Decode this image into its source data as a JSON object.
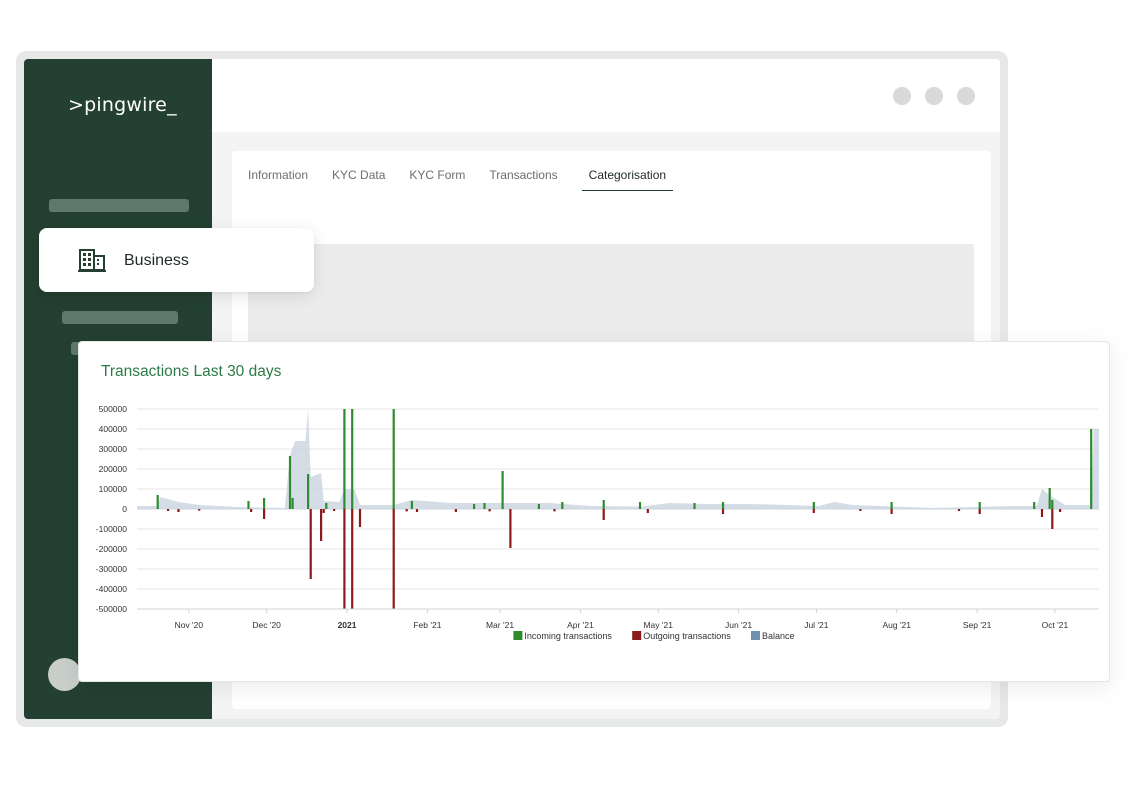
{
  "app": {
    "logo": ">pingwire_"
  },
  "tabs": [
    {
      "label": "Information",
      "active": false
    },
    {
      "label": "KYC Data",
      "active": false
    },
    {
      "label": "KYC Form",
      "active": false
    },
    {
      "label": "Transactions",
      "active": false
    },
    {
      "label": "Categorisation",
      "active": true
    }
  ],
  "business_card": {
    "label": "Business",
    "icon": "building-icon"
  },
  "colors": {
    "sidebar": "#234032",
    "accent": "#2e7a47",
    "incoming": "#2e8b2e",
    "outgoing": "#8b1a1a",
    "balance": "#c9d3de",
    "balance_legend": "#6f8faf"
  },
  "chart_data": {
    "type": "bar",
    "title": "Transactions Last 30 days",
    "ylim": [
      -500000,
      500000
    ],
    "y_ticks": [
      500000,
      400000,
      300000,
      200000,
      100000,
      0,
      -100000,
      -200000,
      -300000,
      -400000,
      -500000
    ],
    "x_ticks": [
      {
        "label": "Nov '20",
        "bold": false
      },
      {
        "label": "Dec '20",
        "bold": false
      },
      {
        "label": "2021",
        "bold": true
      },
      {
        "label": "Feb '21",
        "bold": false
      },
      {
        "label": "Mar '21",
        "bold": false
      },
      {
        "label": "Apr '21",
        "bold": false
      },
      {
        "label": "May '21",
        "bold": false
      },
      {
        "label": "Jun '21",
        "bold": false
      },
      {
        "label": "Jul '21",
        "bold": false
      },
      {
        "label": "Aug '21",
        "bold": false
      },
      {
        "label": "Sep '21",
        "bold": false
      },
      {
        "label": "Oct '21",
        "bold": false
      }
    ],
    "x_range": [
      "2020-10-12",
      "2021-10-18"
    ],
    "grid": true,
    "legend_position": "bottom",
    "series": [
      {
        "name": "Incoming transactions",
        "kind": "incoming",
        "points": [
          [
            "2020-10-20",
            70000
          ],
          [
            "2020-11-24",
            40000
          ],
          [
            "2020-11-30",
            55000
          ],
          [
            "2020-12-10",
            265000
          ],
          [
            "2020-12-11",
            55000
          ],
          [
            "2020-12-17",
            175000
          ],
          [
            "2020-12-24",
            30000
          ],
          [
            "2020-12-31",
            500000
          ],
          [
            "2021-01-03",
            500000
          ],
          [
            "2021-01-19",
            500000
          ],
          [
            "2021-01-26",
            40000
          ],
          [
            "2021-02-19",
            25000
          ],
          [
            "2021-02-23",
            30000
          ],
          [
            "2021-03-02",
            190000
          ],
          [
            "2021-03-16",
            25000
          ],
          [
            "2021-03-25",
            35000
          ],
          [
            "2021-04-10",
            45000
          ],
          [
            "2021-04-24",
            35000
          ],
          [
            "2021-05-15",
            30000
          ],
          [
            "2021-05-26",
            35000
          ],
          [
            "2021-06-30",
            35000
          ],
          [
            "2021-07-30",
            35000
          ],
          [
            "2021-09-02",
            35000
          ],
          [
            "2021-09-23",
            35000
          ],
          [
            "2021-09-29",
            105000
          ],
          [
            "2021-09-30",
            45000
          ],
          [
            "2021-10-15",
            400000
          ]
        ]
      },
      {
        "name": "Outgoing transactions",
        "kind": "outgoing",
        "points": [
          [
            "2020-10-24",
            -10000
          ],
          [
            "2020-10-28",
            -15000
          ],
          [
            "2020-11-05",
            -8000
          ],
          [
            "2020-11-25",
            -15000
          ],
          [
            "2020-11-30",
            -50000
          ],
          [
            "2020-12-18",
            -350000
          ],
          [
            "2020-12-22",
            -160000
          ],
          [
            "2020-12-23",
            -20000
          ],
          [
            "2020-12-27",
            -10000
          ],
          [
            "2020-12-31",
            -500000
          ],
          [
            "2021-01-03",
            -500000
          ],
          [
            "2021-01-06",
            -90000
          ],
          [
            "2021-01-19",
            -500000
          ],
          [
            "2021-01-24",
            -12000
          ],
          [
            "2021-01-28",
            -15000
          ],
          [
            "2021-02-12",
            -15000
          ],
          [
            "2021-02-25",
            -12000
          ],
          [
            "2021-03-05",
            -195000
          ],
          [
            "2021-03-22",
            -12000
          ],
          [
            "2021-04-10",
            -55000
          ],
          [
            "2021-04-27",
            -20000
          ],
          [
            "2021-05-26",
            -25000
          ],
          [
            "2021-06-30",
            -20000
          ],
          [
            "2021-07-18",
            -10000
          ],
          [
            "2021-07-30",
            -25000
          ],
          [
            "2021-08-25",
            -10000
          ],
          [
            "2021-09-02",
            -25000
          ],
          [
            "2021-09-26",
            -40000
          ],
          [
            "2021-09-30",
            -100000
          ],
          [
            "2021-10-03",
            -15000
          ]
        ]
      },
      {
        "name": "Balance",
        "kind": "balance",
        "points": [
          [
            "2020-10-12",
            15000
          ],
          [
            "2020-10-20",
            15000
          ],
          [
            "2020-10-21",
            60000
          ],
          [
            "2020-10-28",
            35000
          ],
          [
            "2020-11-05",
            20000
          ],
          [
            "2020-11-20",
            10000
          ],
          [
            "2020-12-08",
            5000
          ],
          [
            "2020-12-10",
            270000
          ],
          [
            "2020-12-12",
            340000
          ],
          [
            "2020-12-16",
            340000
          ],
          [
            "2020-12-17",
            500000
          ],
          [
            "2020-12-18",
            160000
          ],
          [
            "2020-12-22",
            180000
          ],
          [
            "2020-12-23",
            40000
          ],
          [
            "2020-12-29",
            35000
          ],
          [
            "2020-12-31",
            100000
          ],
          [
            "2021-01-04",
            95000
          ],
          [
            "2021-01-06",
            20000
          ],
          [
            "2021-01-19",
            20000
          ],
          [
            "2021-01-26",
            45000
          ],
          [
            "2021-02-10",
            30000
          ],
          [
            "2021-03-02",
            30000
          ],
          [
            "2021-03-20",
            30000
          ],
          [
            "2021-04-05",
            15000
          ],
          [
            "2021-04-25",
            12000
          ],
          [
            "2021-05-05",
            30000
          ],
          [
            "2021-05-20",
            25000
          ],
          [
            "2021-06-05",
            25000
          ],
          [
            "2021-06-15",
            22000
          ],
          [
            "2021-07-02",
            15000
          ],
          [
            "2021-07-08",
            35000
          ],
          [
            "2021-07-15",
            20000
          ],
          [
            "2021-08-15",
            5000
          ],
          [
            "2021-09-15",
            15000
          ],
          [
            "2021-09-24",
            15000
          ],
          [
            "2021-09-26",
            100000
          ],
          [
            "2021-09-30",
            60000
          ],
          [
            "2021-10-05",
            20000
          ],
          [
            "2021-10-15",
            20000
          ],
          [
            "2021-10-16",
            400000
          ],
          [
            "2021-10-18",
            400000
          ]
        ]
      }
    ]
  }
}
